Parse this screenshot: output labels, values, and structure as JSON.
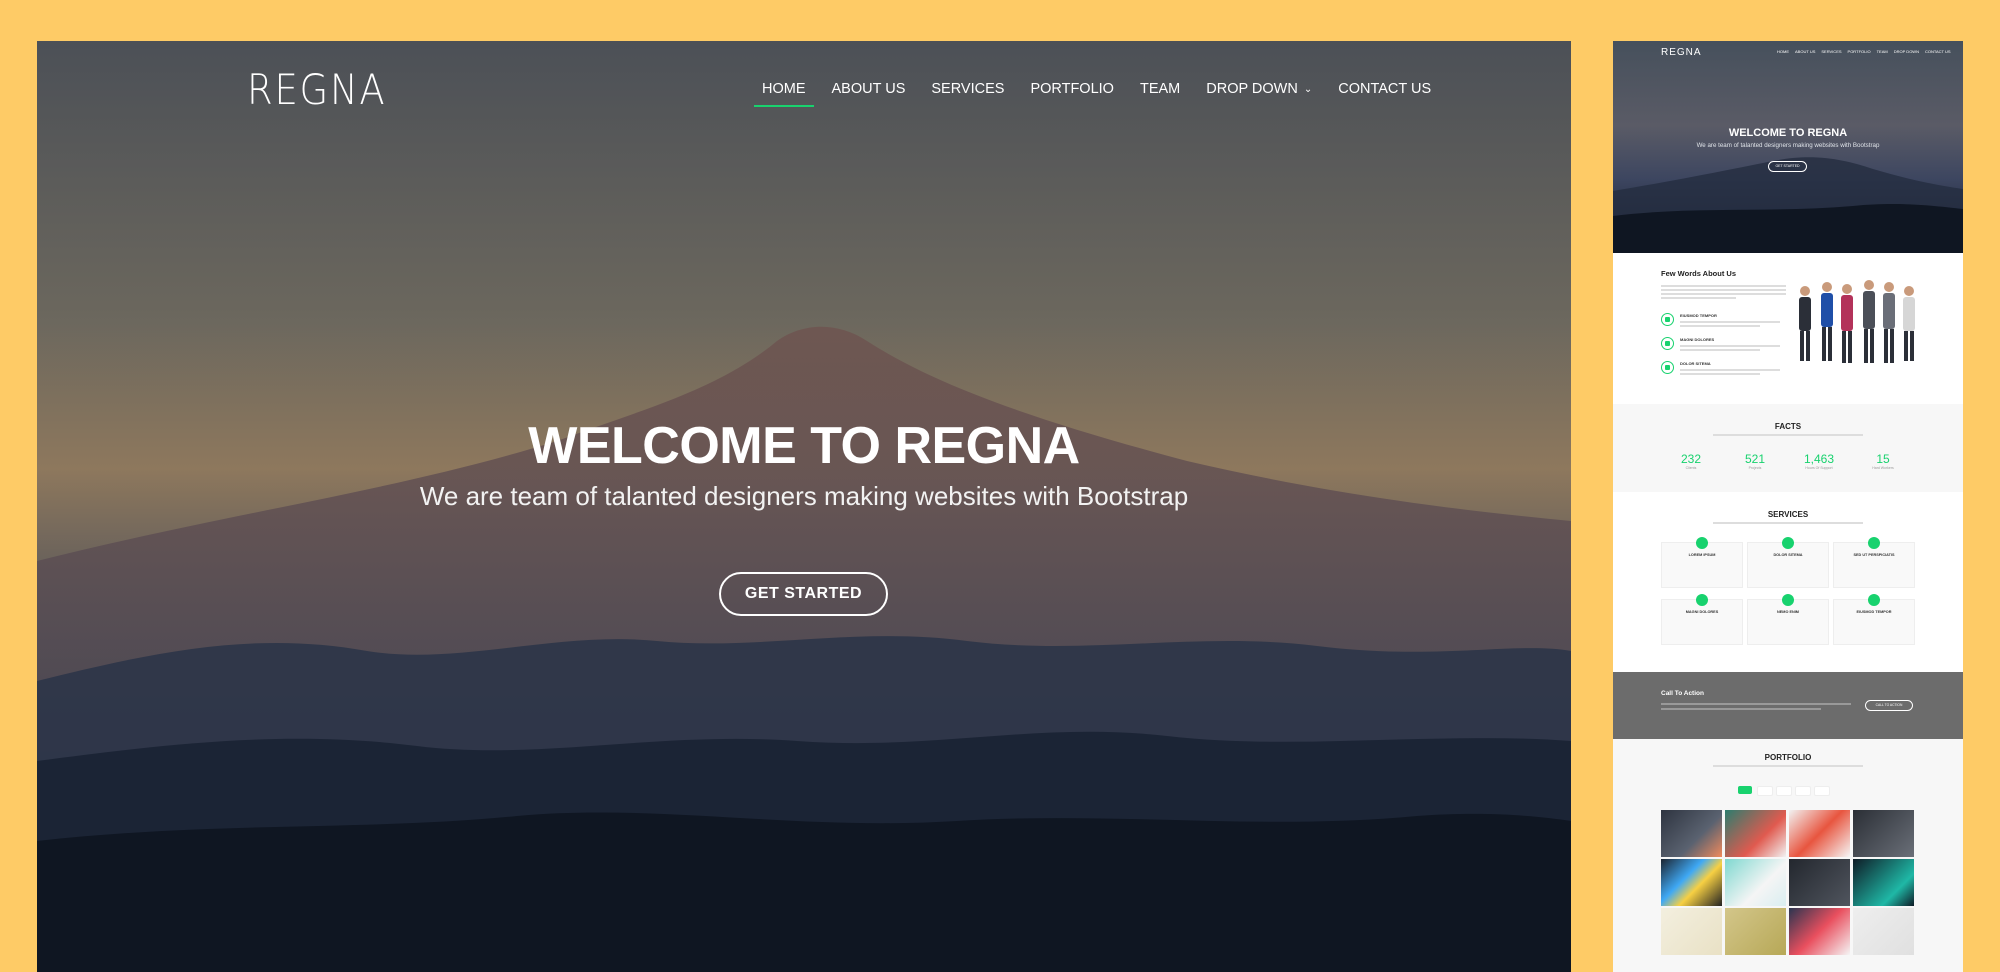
{
  "hero": {
    "logo": "REGNA",
    "nav": [
      {
        "label": "HOME",
        "active": true
      },
      {
        "label": "ABOUT US"
      },
      {
        "label": "SERVICES"
      },
      {
        "label": "PORTFOLIO"
      },
      {
        "label": "TEAM"
      },
      {
        "label": "DROP DOWN"
      },
      {
        "label": "CONTACT US"
      }
    ],
    "title": "WELCOME TO REGNA",
    "subtitle": "We are team of talanted designers making websites with Bootstrap",
    "cta": "GET STARTED"
  },
  "preview": {
    "logo": "REGNA",
    "nav": [
      "HOME",
      "ABOUT US",
      "SERVICES",
      "PORTFOLIO",
      "TEAM",
      "DROP DOWN",
      "CONTACT US"
    ],
    "title": "WELCOME TO REGNA",
    "subtitle": "We are team of talanted designers making websites with Bootstrap",
    "cta": "GET STARTED",
    "about": {
      "title": "Few Words About Us",
      "features": [
        {
          "title": "EIUSMOD TEMPOR"
        },
        {
          "title": "MAGNI DOLORES"
        },
        {
          "title": "DOLOR SITEMA"
        }
      ]
    },
    "facts": {
      "title": "FACTS",
      "items": [
        {
          "value": "232",
          "label": "Clients"
        },
        {
          "value": "521",
          "label": "Projects"
        },
        {
          "value": "1,463",
          "label": "Hours Of Support"
        },
        {
          "value": "15",
          "label": "Hard Workers"
        }
      ]
    },
    "services": {
      "title": "SERVICES",
      "items": [
        "LOREM IPSUM",
        "DOLOR SITEMA",
        "SED UT PERSPICIATIS",
        "MAGNI DOLORES",
        "NEMO ENIM",
        "EIUSMOD TEMPOR"
      ]
    },
    "cta_section": {
      "title": "Call To Action",
      "button": "CALL TO ACTION"
    },
    "portfolio": {
      "title": "PORTFOLIO"
    }
  }
}
